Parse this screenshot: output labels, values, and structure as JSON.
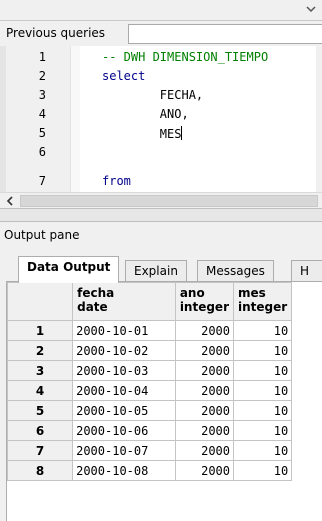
{
  "previous_queries": {
    "label": "Previous queries",
    "value": ""
  },
  "editor": {
    "line_numbers": [
      "1",
      "2",
      "3",
      "4",
      "5",
      "6",
      "7"
    ],
    "lines": [
      {
        "text": "-- DWH DIMENSION_TIEMPO",
        "style": "comment"
      },
      {
        "text": "select",
        "style": "kw"
      },
      {
        "text": "        FECHA,",
        "style": "plain"
      },
      {
        "text": "        ANO,",
        "style": "plain"
      },
      {
        "text": "        MES",
        "style": "plain"
      },
      {
        "text": "",
        "style": "plain"
      },
      {
        "text": "from",
        "style": "kw"
      }
    ]
  },
  "output_pane": {
    "title": "Output pane",
    "tabs": [
      "Data Output",
      "Explain",
      "Messages",
      "H"
    ],
    "active_tab": "Data Output",
    "columns": [
      {
        "name": "fecha",
        "type": "date"
      },
      {
        "name": "ano",
        "type": "integer"
      },
      {
        "name": "mes",
        "type": "integer"
      }
    ],
    "rows": [
      {
        "n": "1",
        "fecha": "2000-10-01",
        "ano": "2000",
        "mes": "10"
      },
      {
        "n": "2",
        "fecha": "2000-10-02",
        "ano": "2000",
        "mes": "10"
      },
      {
        "n": "3",
        "fecha": "2000-10-03",
        "ano": "2000",
        "mes": "10"
      },
      {
        "n": "4",
        "fecha": "2000-10-04",
        "ano": "2000",
        "mes": "10"
      },
      {
        "n": "5",
        "fecha": "2000-10-05",
        "ano": "2000",
        "mes": "10"
      },
      {
        "n": "6",
        "fecha": "2000-10-06",
        "ano": "2000",
        "mes": "10"
      },
      {
        "n": "7",
        "fecha": "2000-10-07",
        "ano": "2000",
        "mes": "10"
      },
      {
        "n": "8",
        "fecha": "2000-10-08",
        "ano": "2000",
        "mes": "10"
      }
    ]
  },
  "colors": {
    "comment": "#008000",
    "keyword": "#00008b",
    "grid_border": "#c4c4c4"
  },
  "icons": {
    "dropdown": "chevron-down-icon",
    "scroll_left": "arrow-left-icon"
  }
}
